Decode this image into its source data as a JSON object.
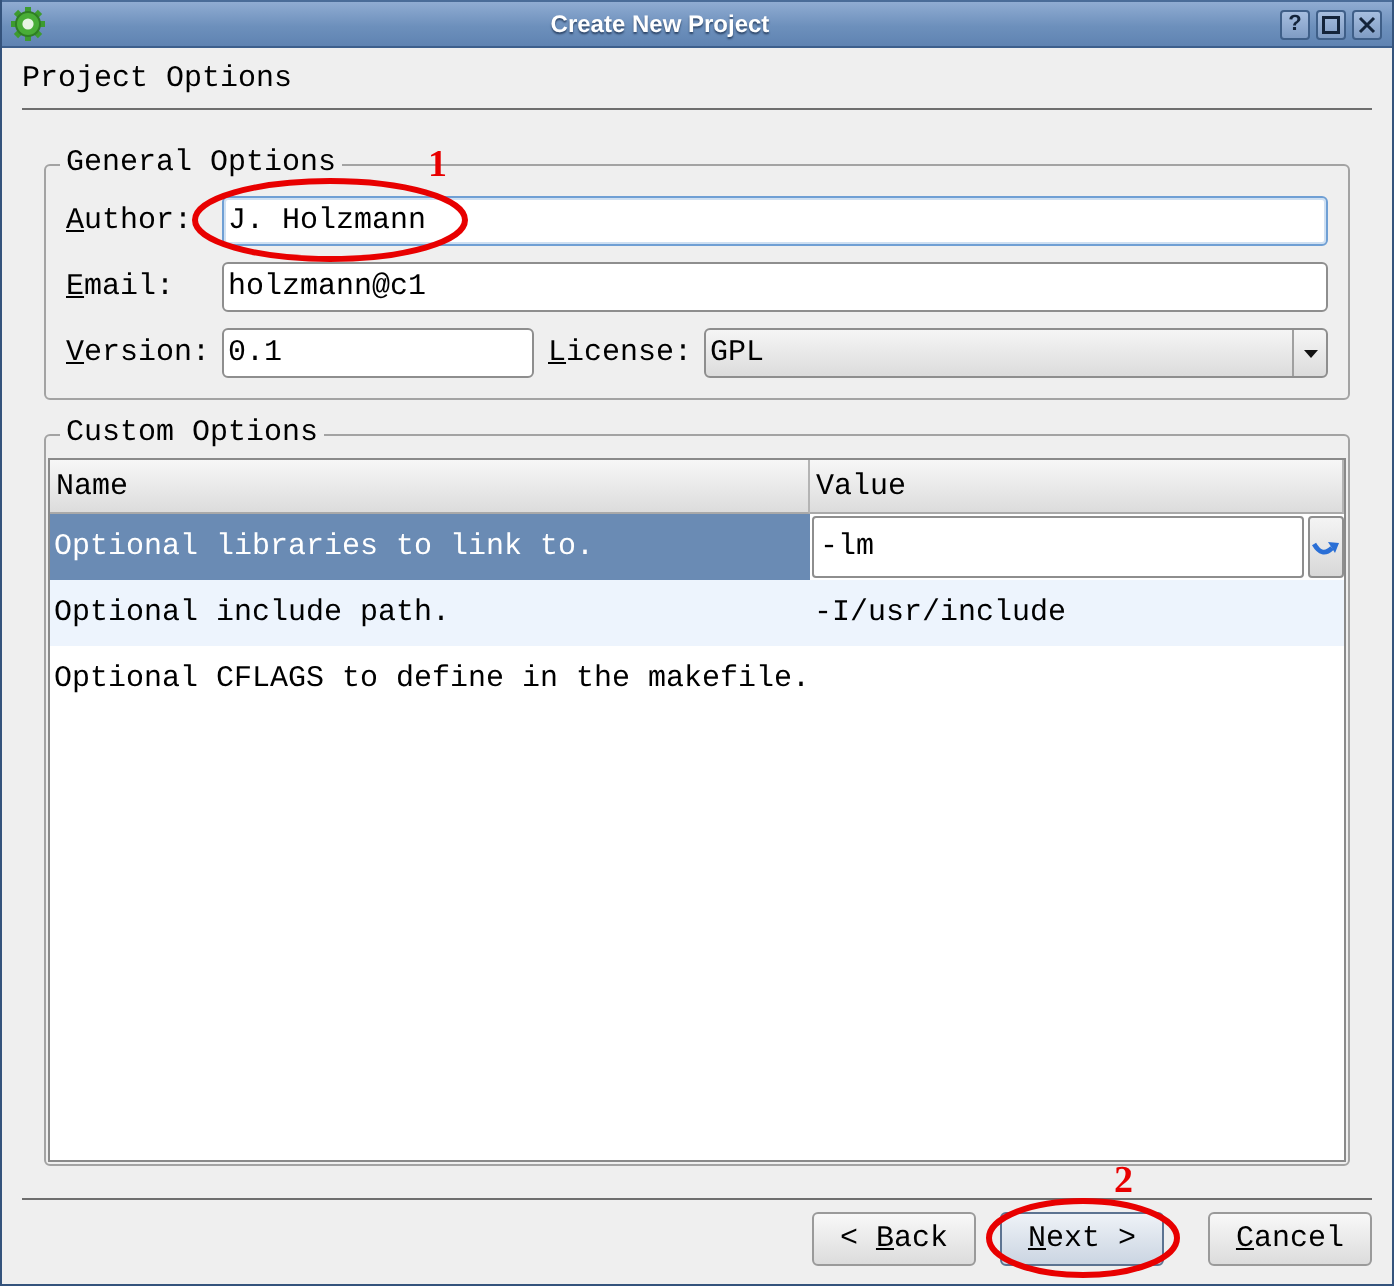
{
  "window": {
    "title": "Create New Project",
    "title_bar_buttons": [
      {
        "kind": "help",
        "label": "?"
      },
      {
        "kind": "maximize"
      },
      {
        "kind": "close"
      }
    ]
  },
  "page": {
    "heading": "Project Options"
  },
  "general_options": {
    "title": "General Options",
    "rows": [
      {
        "fields": [
          {
            "kind": "text",
            "label": "Author:",
            "shortcut_underlined": true,
            "value": "J. Holzmann",
            "focused": true,
            "annotation": "1"
          }
        ]
      },
      {
        "fields": [
          {
            "kind": "text",
            "label": "Email:",
            "shortcut_underlined": true,
            "value": "holzmann@c1",
            "focused": false
          }
        ]
      },
      {
        "fields": [
          {
            "kind": "text",
            "label": "Version:",
            "shortcut_underlined": true,
            "value": "0.1",
            "focused": false
          },
          {
            "kind": "dropdown",
            "label": "License:",
            "shortcut_underlined": true,
            "value": "GPL",
            "focused": false
          }
        ]
      }
    ]
  },
  "custom_options": {
    "title": "Custom Options",
    "columns": [
      "Name",
      "Value"
    ],
    "rows": [
      {
        "name": "Optional libraries to link to.",
        "value": "-lm",
        "selected": true,
        "editing": true
      },
      {
        "name": "Optional include path.",
        "value": "-I/usr/include",
        "selected": false,
        "editing": false
      },
      {
        "name": "Optional CFLAGS to define in the makefile.",
        "selected": false,
        "editing": false
      }
    ]
  },
  "buttons": [
    {
      "kind": "navigation",
      "label": "< Back",
      "shortcut_underlined": true,
      "default": false
    },
    {
      "kind": "navigation",
      "label": "Next >",
      "shortcut_underlined": true,
      "default": true,
      "annotation": "2"
    },
    {
      "kind": "cancel",
      "label": "Cancel",
      "shortcut_underlined": true,
      "default": false
    }
  ]
}
